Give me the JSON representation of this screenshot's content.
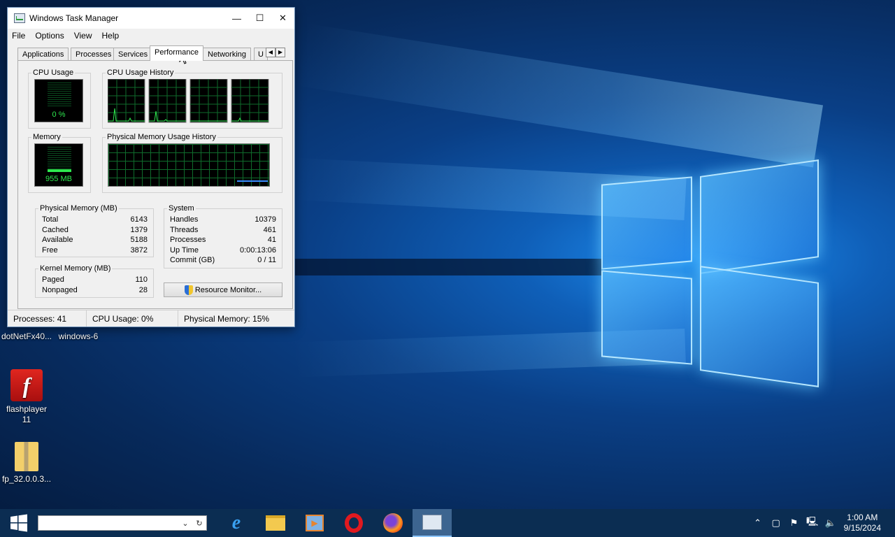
{
  "window": {
    "title": "Windows Task Manager",
    "menu": [
      "File",
      "Options",
      "View",
      "Help"
    ],
    "tabs": [
      "Applications",
      "Processes",
      "Services",
      "Performance",
      "Networking",
      "U"
    ],
    "active_tab": "Performance"
  },
  "performance": {
    "cpu_usage_label": "CPU Usage",
    "cpu_usage_value": "0 %",
    "cpu_history_label": "CPU Usage History",
    "memory_label": "Memory",
    "memory_value": "955 MB",
    "mem_history_label": "Physical Memory Usage History"
  },
  "physical_memory": {
    "title": "Physical Memory (MB)",
    "rows": [
      {
        "label": "Total",
        "value": "6143"
      },
      {
        "label": "Cached",
        "value": "1379"
      },
      {
        "label": "Available",
        "value": "5188"
      },
      {
        "label": "Free",
        "value": "3872"
      }
    ]
  },
  "kernel_memory": {
    "title": "Kernel Memory (MB)",
    "rows": [
      {
        "label": "Paged",
        "value": "110"
      },
      {
        "label": "Nonpaged",
        "value": "28"
      }
    ]
  },
  "system": {
    "title": "System",
    "rows": [
      {
        "label": "Handles",
        "value": "10379"
      },
      {
        "label": "Threads",
        "value": "461"
      },
      {
        "label": "Processes",
        "value": "41"
      },
      {
        "label": "Up Time",
        "value": "0:00:13:06"
      },
      {
        "label": "Commit (GB)",
        "value": "0 / 11"
      }
    ]
  },
  "resource_monitor_label": "Resource Monitor...",
  "status": {
    "processes": "Processes: 41",
    "cpu": "CPU Usage: 0%",
    "memory": "Physical Memory: 15%"
  },
  "desktop_icons": {
    "dotnet": "dotNetFx40...",
    "windows6": "windows-6",
    "flash_line1": "flashplayer",
    "flash_line2": "11",
    "fp": "fp_32.0.0.3..."
  },
  "clock": {
    "time": "1:00 AM",
    "date": "9/15/2024"
  },
  "colors": {
    "graph_green": "#2ee84f",
    "taskbar": "#0b2d52",
    "mem_line": "#3a8cff"
  }
}
